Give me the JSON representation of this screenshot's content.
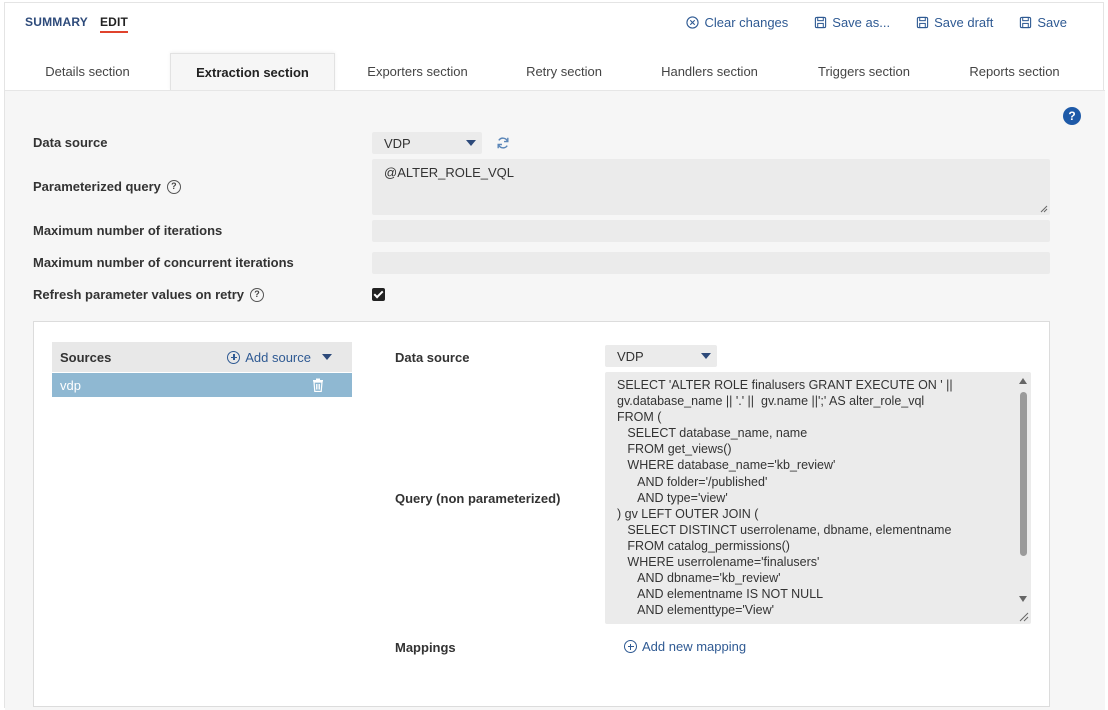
{
  "mode_tabs": {
    "summary": "SUMMARY",
    "edit": "EDIT"
  },
  "actions": {
    "clear": "Clear changes",
    "save_as": "Save as...",
    "save_draft": "Save draft",
    "save": "Save"
  },
  "section_tabs": [
    "Details section",
    "Extraction section",
    "Exporters section",
    "Retry section",
    "Handlers section",
    "Triggers section",
    "Reports section"
  ],
  "active_section": "Extraction section",
  "form": {
    "data_source_label": "Data source",
    "data_source_value": "VDP",
    "param_query_label": "Parameterized query",
    "param_query_value": "@ALTER_ROLE_VQL",
    "max_iter_label": "Maximum number of iterations",
    "max_iter_value": "",
    "max_concurrent_label": "Maximum number of concurrent iterations",
    "max_concurrent_value": "",
    "refresh_label": "Refresh parameter values on retry",
    "refresh_checked": true
  },
  "sources": {
    "title": "Sources",
    "add_label": "Add source",
    "items": [
      {
        "name": "vdp"
      }
    ]
  },
  "source_detail": {
    "data_source_label": "Data source",
    "data_source_value": "VDP",
    "query_label": "Query (non parameterized)",
    "query_lines": [
      "SELECT 'ALTER ROLE finalusers GRANT EXECUTE ON ' ||",
      "gv.database_name || '.' ||  gv.name ||';' AS alter_role_vql",
      "FROM (",
      "   SELECT database_name, name",
      "   FROM get_views()",
      "   WHERE database_name='kb_review'",
      "      AND folder='/published'",
      "      AND type='view'",
      ") gv LEFT OUTER JOIN (",
      "   SELECT DISTINCT userrolename, dbname, elementname",
      "   FROM catalog_permissions()",
      "   WHERE userrolename='finalusers'",
      "      AND dbname='kb_review'",
      "      AND elementname IS NOT NULL",
      "      AND elementtype='View'"
    ],
    "mappings_label": "Mappings",
    "add_mapping_label": "Add new mapping"
  },
  "colors": {
    "accent": "#2f5a93",
    "active_underline": "#e0432c",
    "selected_row": "#8fb8d2"
  }
}
